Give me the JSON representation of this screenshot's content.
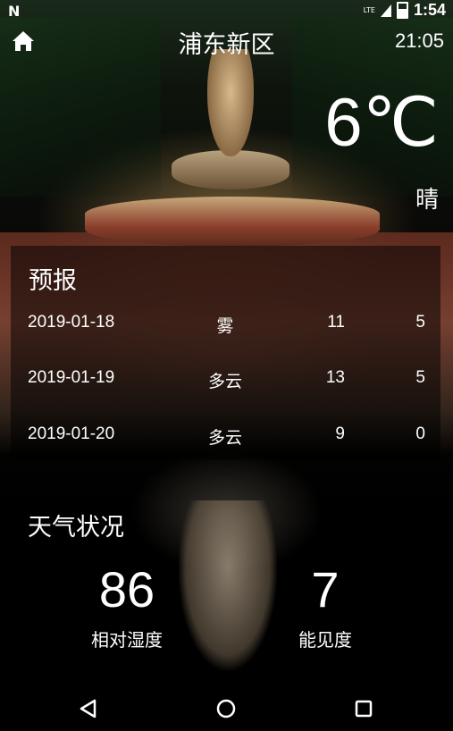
{
  "status_bar": {
    "notification_icon": "n-icon",
    "network_label": "LTE",
    "time": "1:54"
  },
  "header": {
    "home_icon": "home-icon",
    "city": "浦东新区",
    "update_time": "21:05"
  },
  "current": {
    "temperature": "6℃",
    "condition": "晴"
  },
  "forecast": {
    "title": "预报",
    "rows": [
      {
        "date": "2019-01-18",
        "condition": "雾",
        "high": "11",
        "low": "5"
      },
      {
        "date": "2019-01-19",
        "condition": "多云",
        "high": "13",
        "low": "5"
      },
      {
        "date": "2019-01-20",
        "condition": "多云",
        "high": "9",
        "low": "0"
      }
    ]
  },
  "weather_status": {
    "title": "天气状况",
    "humidity": {
      "value": "86",
      "label": "相对湿度"
    },
    "visibility": {
      "value": "7",
      "label": "能见度"
    }
  },
  "nav": {
    "back_icon": "back-triangle-icon",
    "home_icon": "home-circle-icon",
    "recents_icon": "recents-square-icon"
  }
}
